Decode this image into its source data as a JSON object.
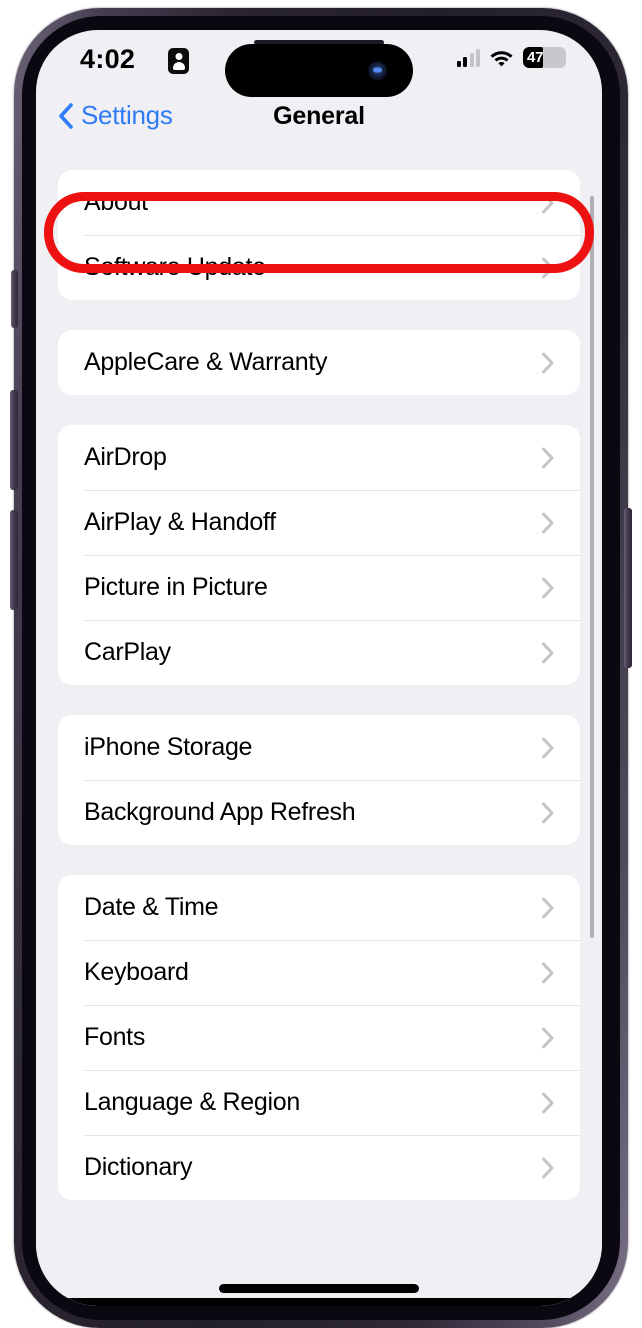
{
  "status_bar": {
    "time": "4:02",
    "focus_icon": "contact-focus-icon",
    "cellular_icon": "cellular-signal-icon",
    "cellular_bars_active": 2,
    "wifi_icon": "wifi-icon",
    "battery_percent": "47",
    "battery_level": 47
  },
  "nav": {
    "back_label": "Settings",
    "back_icon": "chevron-left-icon",
    "title": "General"
  },
  "highlight": {
    "target": "About",
    "color": "#ee1111"
  },
  "colors": {
    "accent_blue": "#2f7cf6",
    "background": "#f0eff4",
    "card": "#ffffff",
    "separator": "#e3e3e6",
    "chevron": "#c4c4c8",
    "highlight_red": "#ee1111"
  },
  "groups": [
    {
      "rows": [
        {
          "label": "About",
          "chevron": "chevron-right-icon",
          "highlighted": true
        },
        {
          "label": "Software Update",
          "chevron": "chevron-right-icon"
        }
      ]
    },
    {
      "rows": [
        {
          "label": "AppleCare & Warranty",
          "chevron": "chevron-right-icon"
        }
      ]
    },
    {
      "rows": [
        {
          "label": "AirDrop",
          "chevron": "chevron-right-icon"
        },
        {
          "label": "AirPlay & Handoff",
          "chevron": "chevron-right-icon"
        },
        {
          "label": "Picture in Picture",
          "chevron": "chevron-right-icon"
        },
        {
          "label": "CarPlay",
          "chevron": "chevron-right-icon"
        }
      ]
    },
    {
      "rows": [
        {
          "label": "iPhone Storage",
          "chevron": "chevron-right-icon"
        },
        {
          "label": "Background App Refresh",
          "chevron": "chevron-right-icon"
        }
      ]
    },
    {
      "rows": [
        {
          "label": "Date & Time",
          "chevron": "chevron-right-icon"
        },
        {
          "label": "Keyboard",
          "chevron": "chevron-right-icon"
        },
        {
          "label": "Fonts",
          "chevron": "chevron-right-icon"
        },
        {
          "label": "Language & Region",
          "chevron": "chevron-right-icon"
        },
        {
          "label": "Dictionary",
          "chevron": "chevron-right-icon"
        }
      ]
    }
  ],
  "device": {
    "dynamic_island": "dynamic-island",
    "camera_icon": "front-camera-icon",
    "speaker": "earpiece-speaker",
    "home_indicator": "home-indicator",
    "buttons": [
      {
        "name": "action-button"
      },
      {
        "name": "volume-up-button"
      },
      {
        "name": "volume-down-button"
      },
      {
        "name": "power-button"
      }
    ]
  }
}
